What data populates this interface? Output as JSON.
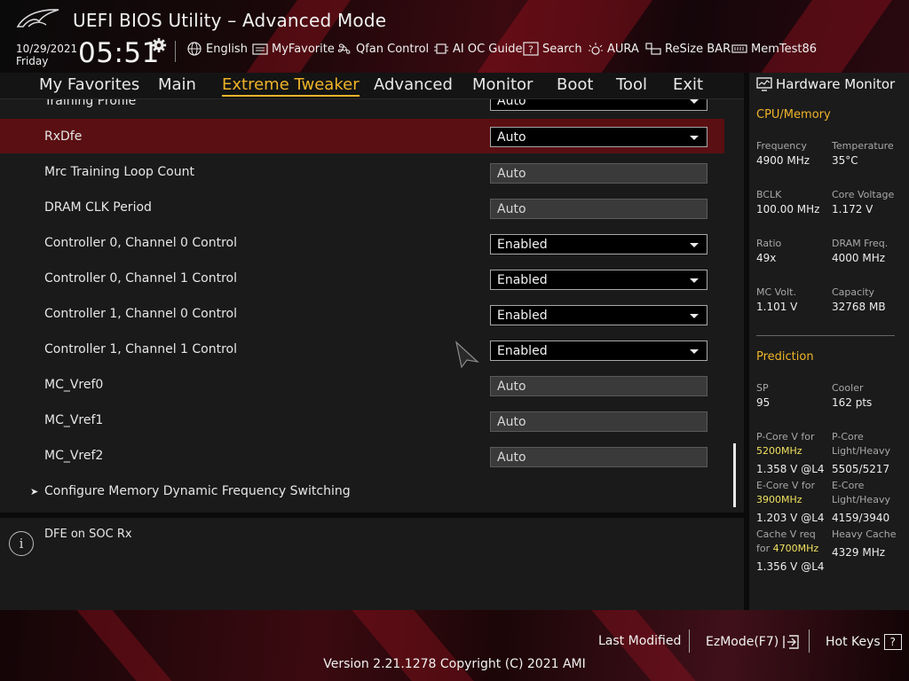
{
  "header": {
    "title": "UEFI BIOS Utility – Advanced Mode",
    "date": "10/29/2021",
    "day": "Friday",
    "time": "05:51",
    "tools": [
      {
        "label": "English",
        "icon": "globe-icon"
      },
      {
        "label": "MyFavorite",
        "icon": "favorite-list-icon"
      },
      {
        "label": "Qfan Control",
        "icon": "fan-icon"
      },
      {
        "label": "AI OC Guide",
        "icon": "chip-icon"
      },
      {
        "label": "Search",
        "icon": "question-box-icon"
      },
      {
        "label": "AURA",
        "icon": "aura-light-icon"
      },
      {
        "label": "ReSize BAR",
        "icon": "resize-bar-icon"
      },
      {
        "label": "MemTest86",
        "icon": "memory-icon"
      }
    ]
  },
  "tabs": [
    "My Favorites",
    "Main",
    "Extreme Tweaker",
    "Advanced",
    "Monitor",
    "Boot",
    "Tool",
    "Exit"
  ],
  "active_tab": "Extreme Tweaker",
  "settings": [
    {
      "label": "Training Profile",
      "value": "Auto",
      "type": "dropdown"
    },
    {
      "label": "RxDfe",
      "value": "Auto",
      "type": "dropdown",
      "selected": true
    },
    {
      "label": "Mrc Training Loop Count",
      "value": "Auto",
      "type": "input"
    },
    {
      "label": "DRAM CLK Period",
      "value": "Auto",
      "type": "input"
    },
    {
      "label": "Controller 0, Channel 0 Control",
      "value": "Enabled",
      "type": "dropdown"
    },
    {
      "label": "Controller 0, Channel 1 Control",
      "value": "Enabled",
      "type": "dropdown"
    },
    {
      "label": "Controller 1, Channel 0 Control",
      "value": "Enabled",
      "type": "dropdown"
    },
    {
      "label": "Controller 1, Channel 1 Control",
      "value": "Enabled",
      "type": "dropdown"
    },
    {
      "label": "MC_Vref0",
      "value": "Auto",
      "type": "input"
    },
    {
      "label": "MC_Vref1",
      "value": "Auto",
      "type": "input"
    },
    {
      "label": "MC_Vref2",
      "value": "Auto",
      "type": "input"
    }
  ],
  "submenu": {
    "label": "Configure Memory Dynamic Frequency Switching"
  },
  "help_text": "DFE on SOC Rx",
  "hw_monitor": {
    "title": "Hardware Monitor",
    "cpu_memory": {
      "title": "CPU/Memory",
      "frequency_label": "Frequency",
      "frequency": "4900 MHz",
      "temperature_label": "Temperature",
      "temperature": "35°C",
      "bclk_label": "BCLK",
      "bclk": "100.00 MHz",
      "core_voltage_label": "Core Voltage",
      "core_voltage": "1.172 V",
      "ratio_label": "Ratio",
      "ratio": "49x",
      "dram_freq_label": "DRAM Freq.",
      "dram_freq": "4000 MHz",
      "mc_volt_label": "MC Volt.",
      "mc_volt": "1.101 V",
      "capacity_label": "Capacity",
      "capacity": "32768 MB"
    },
    "prediction": {
      "title": "Prediction",
      "sp_label": "SP",
      "sp": "95",
      "cooler_label": "Cooler",
      "cooler": "162 pts",
      "pcore_v_label": "P-Core V for",
      "pcore_v_freq": "5200MHz",
      "pcore_v": "1.358 V @L4",
      "pcore_lh_label1": "P-Core",
      "pcore_lh_label2": "Light/Heavy",
      "pcore_lh": "5505/5217",
      "ecore_v_label": "E-Core V for",
      "ecore_v_freq": "3900MHz",
      "ecore_v": "1.203 V @L4",
      "ecore_lh_label1": "E-Core",
      "ecore_lh_label2": "Light/Heavy",
      "ecore_lh": "4159/3940",
      "cache_v_label1": "Cache V req",
      "cache_v_label2": "for",
      "cache_v_freq": "4700MHz",
      "cache_v": "1.356 V @L4",
      "heavy_cache_label": "Heavy Cache",
      "heavy_cache": "4329 MHz"
    }
  },
  "footer": {
    "last_modified": "Last Modified",
    "ezmode": "EzMode(F7)",
    "hot_keys": "Hot Keys",
    "hot_keys_key": "?",
    "version": "Version 2.21.1278 Copyright (C) 2021 AMI"
  },
  "colors": {
    "accent": "#f0b429",
    "selected_row": "#5a0f12",
    "frequency_highlight": "#f0e060"
  }
}
